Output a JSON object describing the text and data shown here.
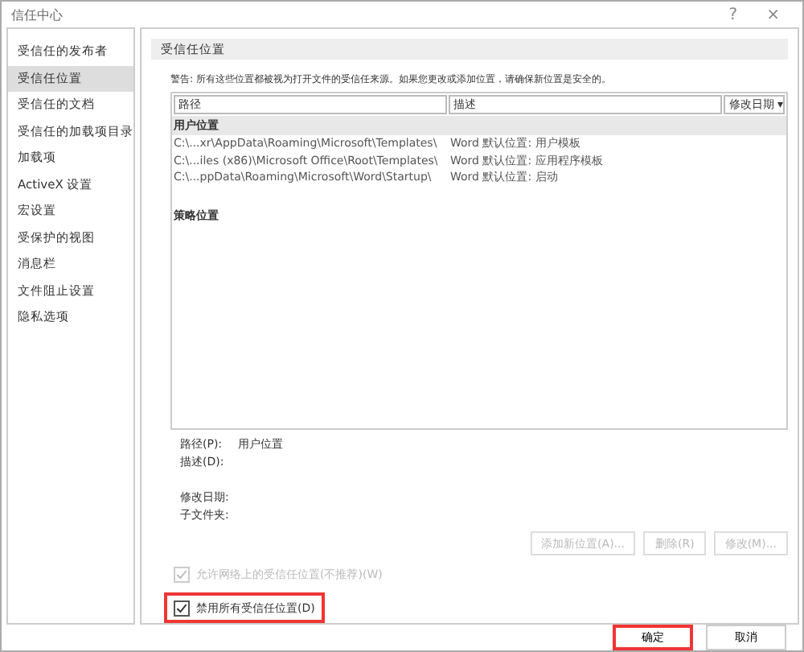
{
  "window": {
    "title": "信任中心",
    "help": "?",
    "close": "×"
  },
  "sidebar": {
    "items": [
      {
        "label": "受信任的发布者",
        "selected": false
      },
      {
        "label": "受信任位置",
        "selected": true
      },
      {
        "label": "受信任的文档",
        "selected": false
      },
      {
        "label": "受信任的加载项目录",
        "selected": false
      },
      {
        "label": "加载项",
        "selected": false
      },
      {
        "label": "ActiveX 设置",
        "selected": false
      },
      {
        "label": "宏设置",
        "selected": false
      },
      {
        "label": "受保护的视图",
        "selected": false
      },
      {
        "label": "消息栏",
        "selected": false
      },
      {
        "label": "文件阻止设置",
        "selected": false
      },
      {
        "label": "隐私选项",
        "selected": false
      }
    ]
  },
  "section": {
    "title": "受信任位置",
    "warning": "警告: 所有这些位置都被视为打开文件的受信任来源。如果您更改或添加位置，请确保新位置是安全的。"
  },
  "table": {
    "columns": [
      "路径",
      "描述",
      "修改日期 ▾"
    ],
    "groups": [
      {
        "title": "用户位置",
        "rows": [
          {
            "path": "C:\\...xr\\AppData\\Roaming\\Microsoft\\Templates\\",
            "description": "Word 默认位置: 用户模板"
          },
          {
            "path": "C:\\...iles (x86)\\Microsoft Office\\Root\\Templates\\",
            "description": "Word 默认位置: 应用程序模板"
          },
          {
            "path": "C:\\...ppData\\Roaming\\Microsoft\\Word\\Startup\\",
            "description": "Word 默认位置: 启动"
          }
        ]
      },
      {
        "title": "策略位置"
      }
    ]
  },
  "details": [
    {
      "label": "路径(P):",
      "value": "用户位置"
    },
    {
      "label": "描述(D):"
    },
    {
      "label": "修改日期:"
    },
    {
      "label": "子文件夹:"
    }
  ],
  "buttons": [
    {
      "label": "添加新位置(A)...",
      "disabled": true
    },
    {
      "label": "删除(R)",
      "disabled": true
    },
    {
      "label": "修改(M)...",
      "disabled": true
    }
  ],
  "checkboxes": [
    {
      "label": "允许网络上的受信任位置(不推荐)(W)",
      "checked": true,
      "disabled": true,
      "highlighted": false
    },
    {
      "label": "禁用所有受信任位置(D)",
      "checked": true,
      "disabled": false,
      "highlighted": true
    }
  ],
  "footer": {
    "buttons": [
      {
        "label": "确定",
        "highlighted": true
      },
      {
        "label": "取消",
        "highlighted": false
      }
    ]
  }
}
